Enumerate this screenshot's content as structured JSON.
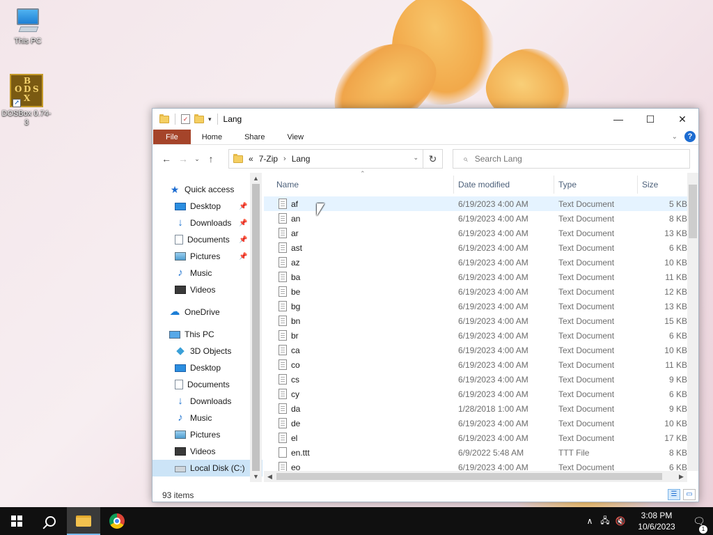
{
  "desktop": {
    "icons": [
      {
        "label": "This PC"
      },
      {
        "label": "DOSBox 0.74-3"
      }
    ],
    "dosbox_glyph": [
      "B",
      "O",
      "D",
      "S",
      "X"
    ]
  },
  "window": {
    "title": "Lang",
    "controls": {
      "minimize": "—",
      "maximize": "☐",
      "close": "✕"
    },
    "ribbon": {
      "tabs": [
        "File",
        "Home",
        "Share",
        "View"
      ]
    },
    "address": {
      "overflow": "«",
      "crumbs": [
        "7-Zip",
        "Lang"
      ]
    },
    "search": {
      "placeholder": "Search Lang"
    },
    "nav": {
      "quick_access": "Quick access",
      "quick_items": [
        "Desktop",
        "Downloads",
        "Documents",
        "Pictures",
        "Music",
        "Videos"
      ],
      "onedrive": "OneDrive",
      "this_pc": "This PC",
      "pc_items": [
        "3D Objects",
        "Desktop",
        "Documents",
        "Downloads",
        "Music",
        "Pictures",
        "Videos",
        "Local Disk (C:)"
      ]
    },
    "columns": {
      "name": "Name",
      "date": "Date modified",
      "type": "Type",
      "size": "Size"
    },
    "files": [
      {
        "name": "af",
        "date": "6/19/2023 4:00 AM",
        "type": "Text Document",
        "size": "5 KB"
      },
      {
        "name": "an",
        "date": "6/19/2023 4:00 AM",
        "type": "Text Document",
        "size": "8 KB"
      },
      {
        "name": "ar",
        "date": "6/19/2023 4:00 AM",
        "type": "Text Document",
        "size": "13 KB"
      },
      {
        "name": "ast",
        "date": "6/19/2023 4:00 AM",
        "type": "Text Document",
        "size": "6 KB"
      },
      {
        "name": "az",
        "date": "6/19/2023 4:00 AM",
        "type": "Text Document",
        "size": "10 KB"
      },
      {
        "name": "ba",
        "date": "6/19/2023 4:00 AM",
        "type": "Text Document",
        "size": "11 KB"
      },
      {
        "name": "be",
        "date": "6/19/2023 4:00 AM",
        "type": "Text Document",
        "size": "12 KB"
      },
      {
        "name": "bg",
        "date": "6/19/2023 4:00 AM",
        "type": "Text Document",
        "size": "13 KB"
      },
      {
        "name": "bn",
        "date": "6/19/2023 4:00 AM",
        "type": "Text Document",
        "size": "15 KB"
      },
      {
        "name": "br",
        "date": "6/19/2023 4:00 AM",
        "type": "Text Document",
        "size": "6 KB"
      },
      {
        "name": "ca",
        "date": "6/19/2023 4:00 AM",
        "type": "Text Document",
        "size": "10 KB"
      },
      {
        "name": "co",
        "date": "6/19/2023 4:00 AM",
        "type": "Text Document",
        "size": "11 KB"
      },
      {
        "name": "cs",
        "date": "6/19/2023 4:00 AM",
        "type": "Text Document",
        "size": "9 KB"
      },
      {
        "name": "cy",
        "date": "6/19/2023 4:00 AM",
        "type": "Text Document",
        "size": "6 KB"
      },
      {
        "name": "da",
        "date": "1/28/2018 1:00 AM",
        "type": "Text Document",
        "size": "9 KB"
      },
      {
        "name": "de",
        "date": "6/19/2023 4:00 AM",
        "type": "Text Document",
        "size": "10 KB"
      },
      {
        "name": "el",
        "date": "6/19/2023 4:00 AM",
        "type": "Text Document",
        "size": "17 KB"
      },
      {
        "name": "en.ttt",
        "date": "6/9/2022 5:48 AM",
        "type": "TTT File",
        "size": "8 KB"
      },
      {
        "name": "eo",
        "date": "6/19/2023 4:00 AM",
        "type": "Text Document",
        "size": "6 KB"
      }
    ],
    "status": {
      "item_count": "93 items"
    }
  },
  "taskbar": {
    "clock": {
      "time": "3:08 PM",
      "date": "10/6/2023"
    },
    "notification_count": "1"
  },
  "colors": {
    "file_tab": "#a5442a",
    "selection": "#cce4f7",
    "hover_row": "#e5f3ff",
    "accent": "#1c6cd1"
  }
}
